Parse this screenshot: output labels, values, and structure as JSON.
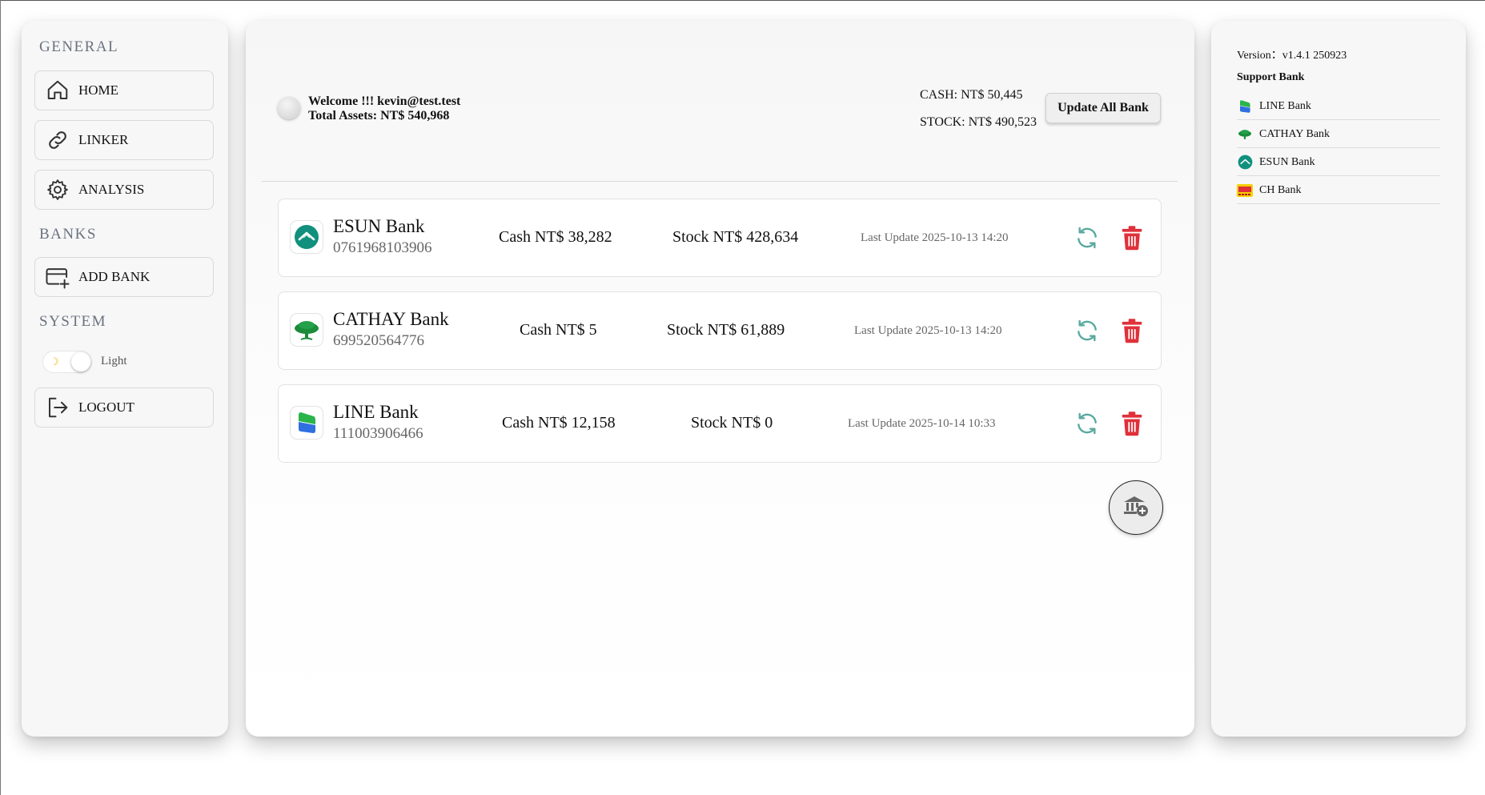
{
  "sidebar": {
    "general_title": "GENERAL",
    "banks_title": "BANKS",
    "system_title": "SYSTEM",
    "nav": {
      "home": "HOME",
      "linker": "LINKER",
      "analysis": "ANALYSIS",
      "add_bank": "ADD BANK",
      "logout": "LOGOUT"
    },
    "theme_toggle": {
      "label": "Light",
      "icon": "moon-icon",
      "state": "light"
    }
  },
  "header": {
    "welcome": "Welcome !!! kevin@test.test",
    "total_assets": "Total Assets: NT$ 540,968",
    "cash": "CASH: NT$ 50,445",
    "stock": "STOCK: NT$ 490,523",
    "update_all": "Update All Bank"
  },
  "banks": [
    {
      "name": "ESUN Bank",
      "account": "0761968103906",
      "cash": "Cash NT$ 38,282",
      "stock": "Stock NT$ 428,634",
      "last_update": "Last Update 2025-10-13 14:20",
      "logo": "esun-logo"
    },
    {
      "name": "CATHAY Bank",
      "account": "699520564776",
      "cash": "Cash NT$ 5",
      "stock": "Stock NT$ 61,889",
      "last_update": "Last Update 2025-10-13 14:20",
      "logo": "cathay-logo"
    },
    {
      "name": "LINE Bank",
      "account": "111003906466",
      "cash": "Cash NT$ 12,158",
      "stock": "Stock NT$ 0",
      "last_update": "Last Update 2025-10-14 10:33",
      "logo": "line-logo"
    }
  ],
  "right_panel": {
    "version": "Version：v1.4.1 250923",
    "support_title": "Support Bank",
    "support_banks": [
      "LINE Bank",
      "CATHAY Bank",
      "ESUN Bank",
      "CH Bank"
    ]
  },
  "colors": {
    "refresh": "#5aa9a0",
    "delete": "#e0303a",
    "esun": "#11907d",
    "cathay": "#1a8c3a",
    "line_green": "#2ab54a",
    "line_blue": "#2f6fe0"
  }
}
